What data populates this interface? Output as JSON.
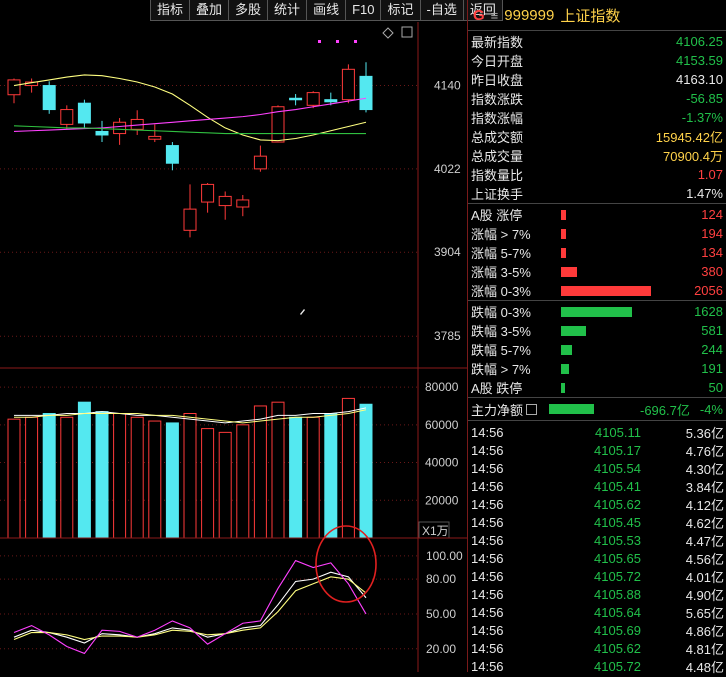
{
  "toolbar": {
    "buttons": [
      "指标",
      "叠加",
      "多股",
      "统计",
      "画线",
      "F10",
      "标记",
      "-自选",
      "返回"
    ]
  },
  "price_axis": {
    "ticks": [
      "4140",
      "4022",
      "3904",
      "3785"
    ]
  },
  "volume_axis": {
    "ticks": [
      "80000",
      "60000",
      "40000",
      "20000"
    ],
    "unit": "X1万"
  },
  "kdj_axis": {
    "ticks": [
      "100.00",
      "80.00",
      "50.00",
      "20.00"
    ]
  },
  "colors": {
    "up": "#ff3a3a",
    "down": "#54e8f0",
    "ma_yellow": "#ffff80",
    "ma_magenta": "#ff40ff",
    "ma_green": "#30c040"
  },
  "chart_data": [
    {
      "type": "candlestick",
      "title": "",
      "y_ticks": [
        4140,
        4022,
        3904,
        3785
      ],
      "ylim": [
        3740,
        4230
      ],
      "candles": [
        {
          "o": 4127,
          "c": 4148,
          "h": 4150,
          "l": 4115
        },
        {
          "o": 4140,
          "c": 4145,
          "h": 4150,
          "l": 4130
        },
        {
          "o": 4140,
          "c": 4106,
          "h": 4146,
          "l": 4100
        },
        {
          "o": 4085,
          "c": 4106,
          "h": 4112,
          "l": 4078
        },
        {
          "o": 4115,
          "c": 4087,
          "h": 4120,
          "l": 4080
        },
        {
          "o": 4075,
          "c": 4070,
          "h": 4090,
          "l": 4060
        },
        {
          "o": 4072,
          "c": 4088,
          "h": 4094,
          "l": 4056
        },
        {
          "o": 4078,
          "c": 4092,
          "h": 4105,
          "l": 4070
        },
        {
          "o": 4064,
          "c": 4068,
          "h": 4085,
          "l": 4060
        },
        {
          "o": 4055,
          "c": 4030,
          "h": 4060,
          "l": 4020
        },
        {
          "o": 3935,
          "c": 3965,
          "h": 4000,
          "l": 3925
        },
        {
          "o": 3975,
          "c": 4000,
          "h": 4002,
          "l": 3960
        },
        {
          "o": 3970,
          "c": 3983,
          "h": 3990,
          "l": 3950
        },
        {
          "o": 3968,
          "c": 3978,
          "h": 3985,
          "l": 3955
        },
        {
          "o": 4022,
          "c": 4040,
          "h": 4055,
          "l": 4018
        },
        {
          "o": 4060,
          "c": 4110,
          "h": 4112,
          "l": 4060
        },
        {
          "o": 4122,
          "c": 4120,
          "h": 4128,
          "l": 4112
        },
        {
          "o": 4112,
          "c": 4130,
          "h": 4132,
          "l": 4108
        },
        {
          "o": 4120,
          "c": 4117,
          "h": 4130,
          "l": 4112
        },
        {
          "o": 4120,
          "c": 4163,
          "h": 4170,
          "l": 4115
        },
        {
          "o": 4153,
          "c": 4106,
          "h": 4173,
          "l": 4102
        }
      ],
      "series": [
        {
          "name": "MA-yellow",
          "values": [
            4140,
            4144,
            4148,
            4152,
            4155,
            4154,
            4150,
            4145,
            4138,
            4128,
            4112,
            4095,
            4080,
            4070,
            4063,
            4062,
            4065,
            4070,
            4076,
            4082,
            4088
          ]
        },
        {
          "name": "MA-magenta",
          "values": [
            4075,
            4076,
            4077,
            4078,
            4079,
            4080,
            4082,
            4084,
            4086,
            4088,
            4090,
            4092,
            4094,
            4096,
            4099,
            4103,
            4106,
            4110,
            4114,
            4118,
            4122
          ]
        },
        {
          "name": "MA-green",
          "values": [
            4083,
            4082,
            4081,
            4080,
            4080,
            4079,
            4078,
            4077,
            4076,
            4075,
            4074,
            4073,
            4072,
            4072,
            4072,
            4072,
            4072,
            4072,
            4072,
            4072,
            4072
          ]
        }
      ]
    },
    {
      "type": "bar",
      "title": "Volume",
      "unit": "X1万",
      "y_ticks": [
        80000,
        60000,
        40000,
        20000
      ],
      "ylim": [
        0,
        88000
      ],
      "values": [
        63000,
        64000,
        66000,
        64000,
        72000,
        67000,
        66000,
        64000,
        62000,
        61000,
        66000,
        58000,
        56000,
        60000,
        70000,
        72000,
        64000,
        64000,
        66000,
        74000,
        70900
      ],
      "up": [
        true,
        true,
        false,
        true,
        false,
        false,
        true,
        true,
        true,
        false,
        true,
        true,
        true,
        true,
        true,
        true,
        false,
        true,
        false,
        true,
        false
      ],
      "series": [
        {
          "name": "VOL-MA-white",
          "values": [
            65000,
            65000,
            65000,
            66000,
            66000,
            67000,
            66000,
            65000,
            65000,
            64000,
            63000,
            62000,
            61000,
            62000,
            63000,
            65000,
            65000,
            66000,
            66000,
            67000,
            69000
          ]
        },
        {
          "name": "VOL-MA-yellow",
          "values": [
            64000,
            64000,
            65000,
            65000,
            66000,
            66000,
            66000,
            66000,
            65000,
            65000,
            64000,
            63000,
            62000,
            61000,
            62000,
            63000,
            64000,
            64000,
            65000,
            66000,
            68000
          ]
        }
      ]
    },
    {
      "type": "line",
      "title": "KDJ",
      "y_ticks": [
        100,
        80,
        50,
        20
      ],
      "ylim": [
        0,
        112
      ],
      "series": [
        {
          "name": "K",
          "values": [
            30,
            36,
            34,
            30,
            25,
            33,
            32,
            30,
            33,
            38,
            36,
            30,
            33,
            38,
            40,
            58,
            78,
            80,
            86,
            82,
            64
          ]
        },
        {
          "name": "D",
          "values": [
            28,
            34,
            34,
            32,
            28,
            31,
            31,
            30,
            32,
            36,
            35,
            32,
            33,
            36,
            38,
            52,
            70,
            76,
            82,
            80,
            68
          ]
        },
        {
          "name": "J",
          "values": [
            34,
            40,
            32,
            22,
            16,
            36,
            35,
            30,
            36,
            44,
            38,
            24,
            33,
            42,
            44,
            72,
            96,
            90,
            94,
            76,
            50
          ]
        }
      ]
    }
  ],
  "panel": {
    "header": {
      "tag": "G",
      "menu_icon": "menu-lines-icon",
      "code": "999999",
      "name": "上证指数"
    },
    "stats": [
      {
        "label": "最新指数",
        "value": "4106.25",
        "color": "green"
      },
      {
        "label": "今日开盘",
        "value": "4153.59",
        "color": "green"
      },
      {
        "label": "昨日收盘",
        "value": "4163.10",
        "color": "white"
      },
      {
        "label": "指数涨跌",
        "value": "-56.85",
        "color": "green"
      },
      {
        "label": "指数涨幅",
        "value": "-1.37%",
        "color": "green"
      },
      {
        "label": "总成交额",
        "value": "15945.42亿",
        "color": "yellow"
      },
      {
        "label": "总成交量",
        "value": "70900.4万",
        "color": "yellow"
      },
      {
        "label": "指数量比",
        "value": "1.07",
        "color": "red"
      },
      {
        "label": "上证换手",
        "value": "1.47%",
        "color": "white"
      }
    ],
    "up_dist": [
      {
        "label": "A股 涨停",
        "value": "124",
        "bar": 0.06
      },
      {
        "label": "涨幅 > 7%",
        "value": "194",
        "bar": 0.06
      },
      {
        "label": "涨幅 5-7%",
        "value": "134",
        "bar": 0.06
      },
      {
        "label": "涨幅 3-5%",
        "value": "380",
        "bar": 0.18
      },
      {
        "label": "涨幅 0-3%",
        "value": "2056",
        "bar": 1.0
      }
    ],
    "down_dist": [
      {
        "label": "跌幅 0-3%",
        "value": "1628",
        "bar": 0.79
      },
      {
        "label": "跌幅 3-5%",
        "value": "581",
        "bar": 0.28
      },
      {
        "label": "跌幅 5-7%",
        "value": "244",
        "bar": 0.12
      },
      {
        "label": "跌幅 > 7%",
        "value": "191",
        "bar": 0.09
      },
      {
        "label": "A股 跌停",
        "value": "50",
        "bar": 0.03
      }
    ],
    "main_flow": {
      "label": "主力净额",
      "icon": "list-icon",
      "value": "-696.7亿",
      "pct": "-4%",
      "bar": 0.5
    },
    "ticks": [
      {
        "time": "14:56",
        "price": "4105.11",
        "amount": "5.36亿"
      },
      {
        "time": "14:56",
        "price": "4105.17",
        "amount": "4.76亿"
      },
      {
        "time": "14:56",
        "price": "4105.54",
        "amount": "4.30亿"
      },
      {
        "time": "14:56",
        "price": "4105.41",
        "amount": "3.84亿"
      },
      {
        "time": "14:56",
        "price": "4105.62",
        "amount": "4.12亿"
      },
      {
        "time": "14:56",
        "price": "4105.45",
        "amount": "4.62亿"
      },
      {
        "time": "14:56",
        "price": "4105.53",
        "amount": "4.47亿"
      },
      {
        "time": "14:56",
        "price": "4105.65",
        "amount": "4.56亿"
      },
      {
        "time": "14:56",
        "price": "4105.72",
        "amount": "4.01亿"
      },
      {
        "time": "14:56",
        "price": "4105.88",
        "amount": "4.90亿"
      },
      {
        "time": "14:56",
        "price": "4105.64",
        "amount": "5.65亿"
      },
      {
        "time": "14:56",
        "price": "4105.69",
        "amount": "4.86亿"
      },
      {
        "time": "14:56",
        "price": "4105.62",
        "amount": "4.81亿"
      },
      {
        "time": "14:56",
        "price": "4105.72",
        "amount": "4.48亿"
      }
    ]
  }
}
